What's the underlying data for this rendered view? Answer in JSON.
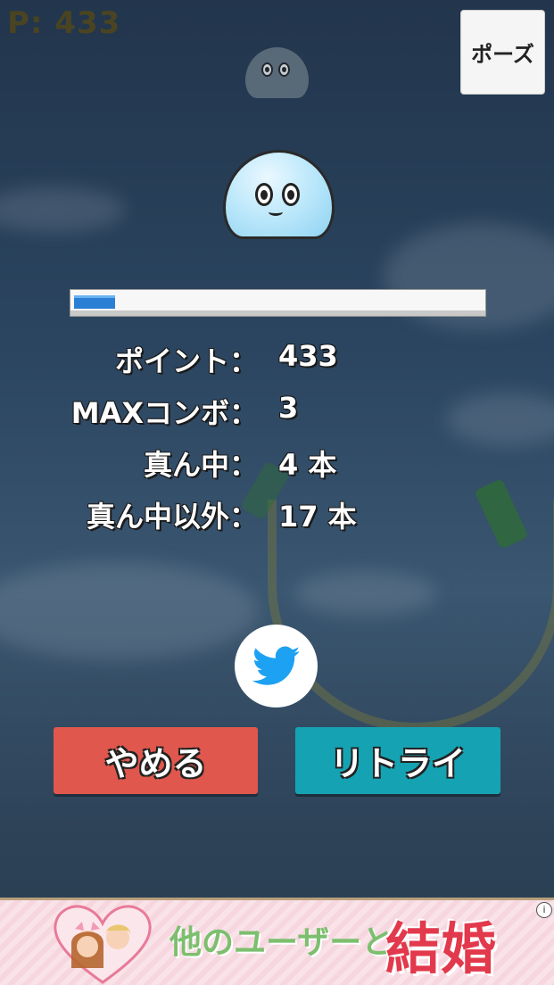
{
  "hud": {
    "score_text": "P: 433"
  },
  "pause_button": {
    "label": "ポーズ"
  },
  "progress": {
    "fill_fraction": 0.1
  },
  "stats": [
    {
      "label": "ポイント：",
      "value": "433"
    },
    {
      "label": "MAXコンボ：",
      "value": "3"
    },
    {
      "label": "真ん中：",
      "value": "4 本"
    },
    {
      "label": "真ん中以外：",
      "value": "17 本"
    }
  ],
  "share": {
    "icon": "twitter-bird-icon",
    "color": "#1da1f2"
  },
  "buttons": {
    "quit_label": "やめる",
    "retry_label": "リトライ"
  },
  "ad": {
    "text": "他のユーザーと",
    "highlight": "結婚",
    "info_icon": "i"
  },
  "colors": {
    "quit": "#e0574d",
    "retry": "#15a3b3",
    "progress": "#2a7fd4"
  }
}
